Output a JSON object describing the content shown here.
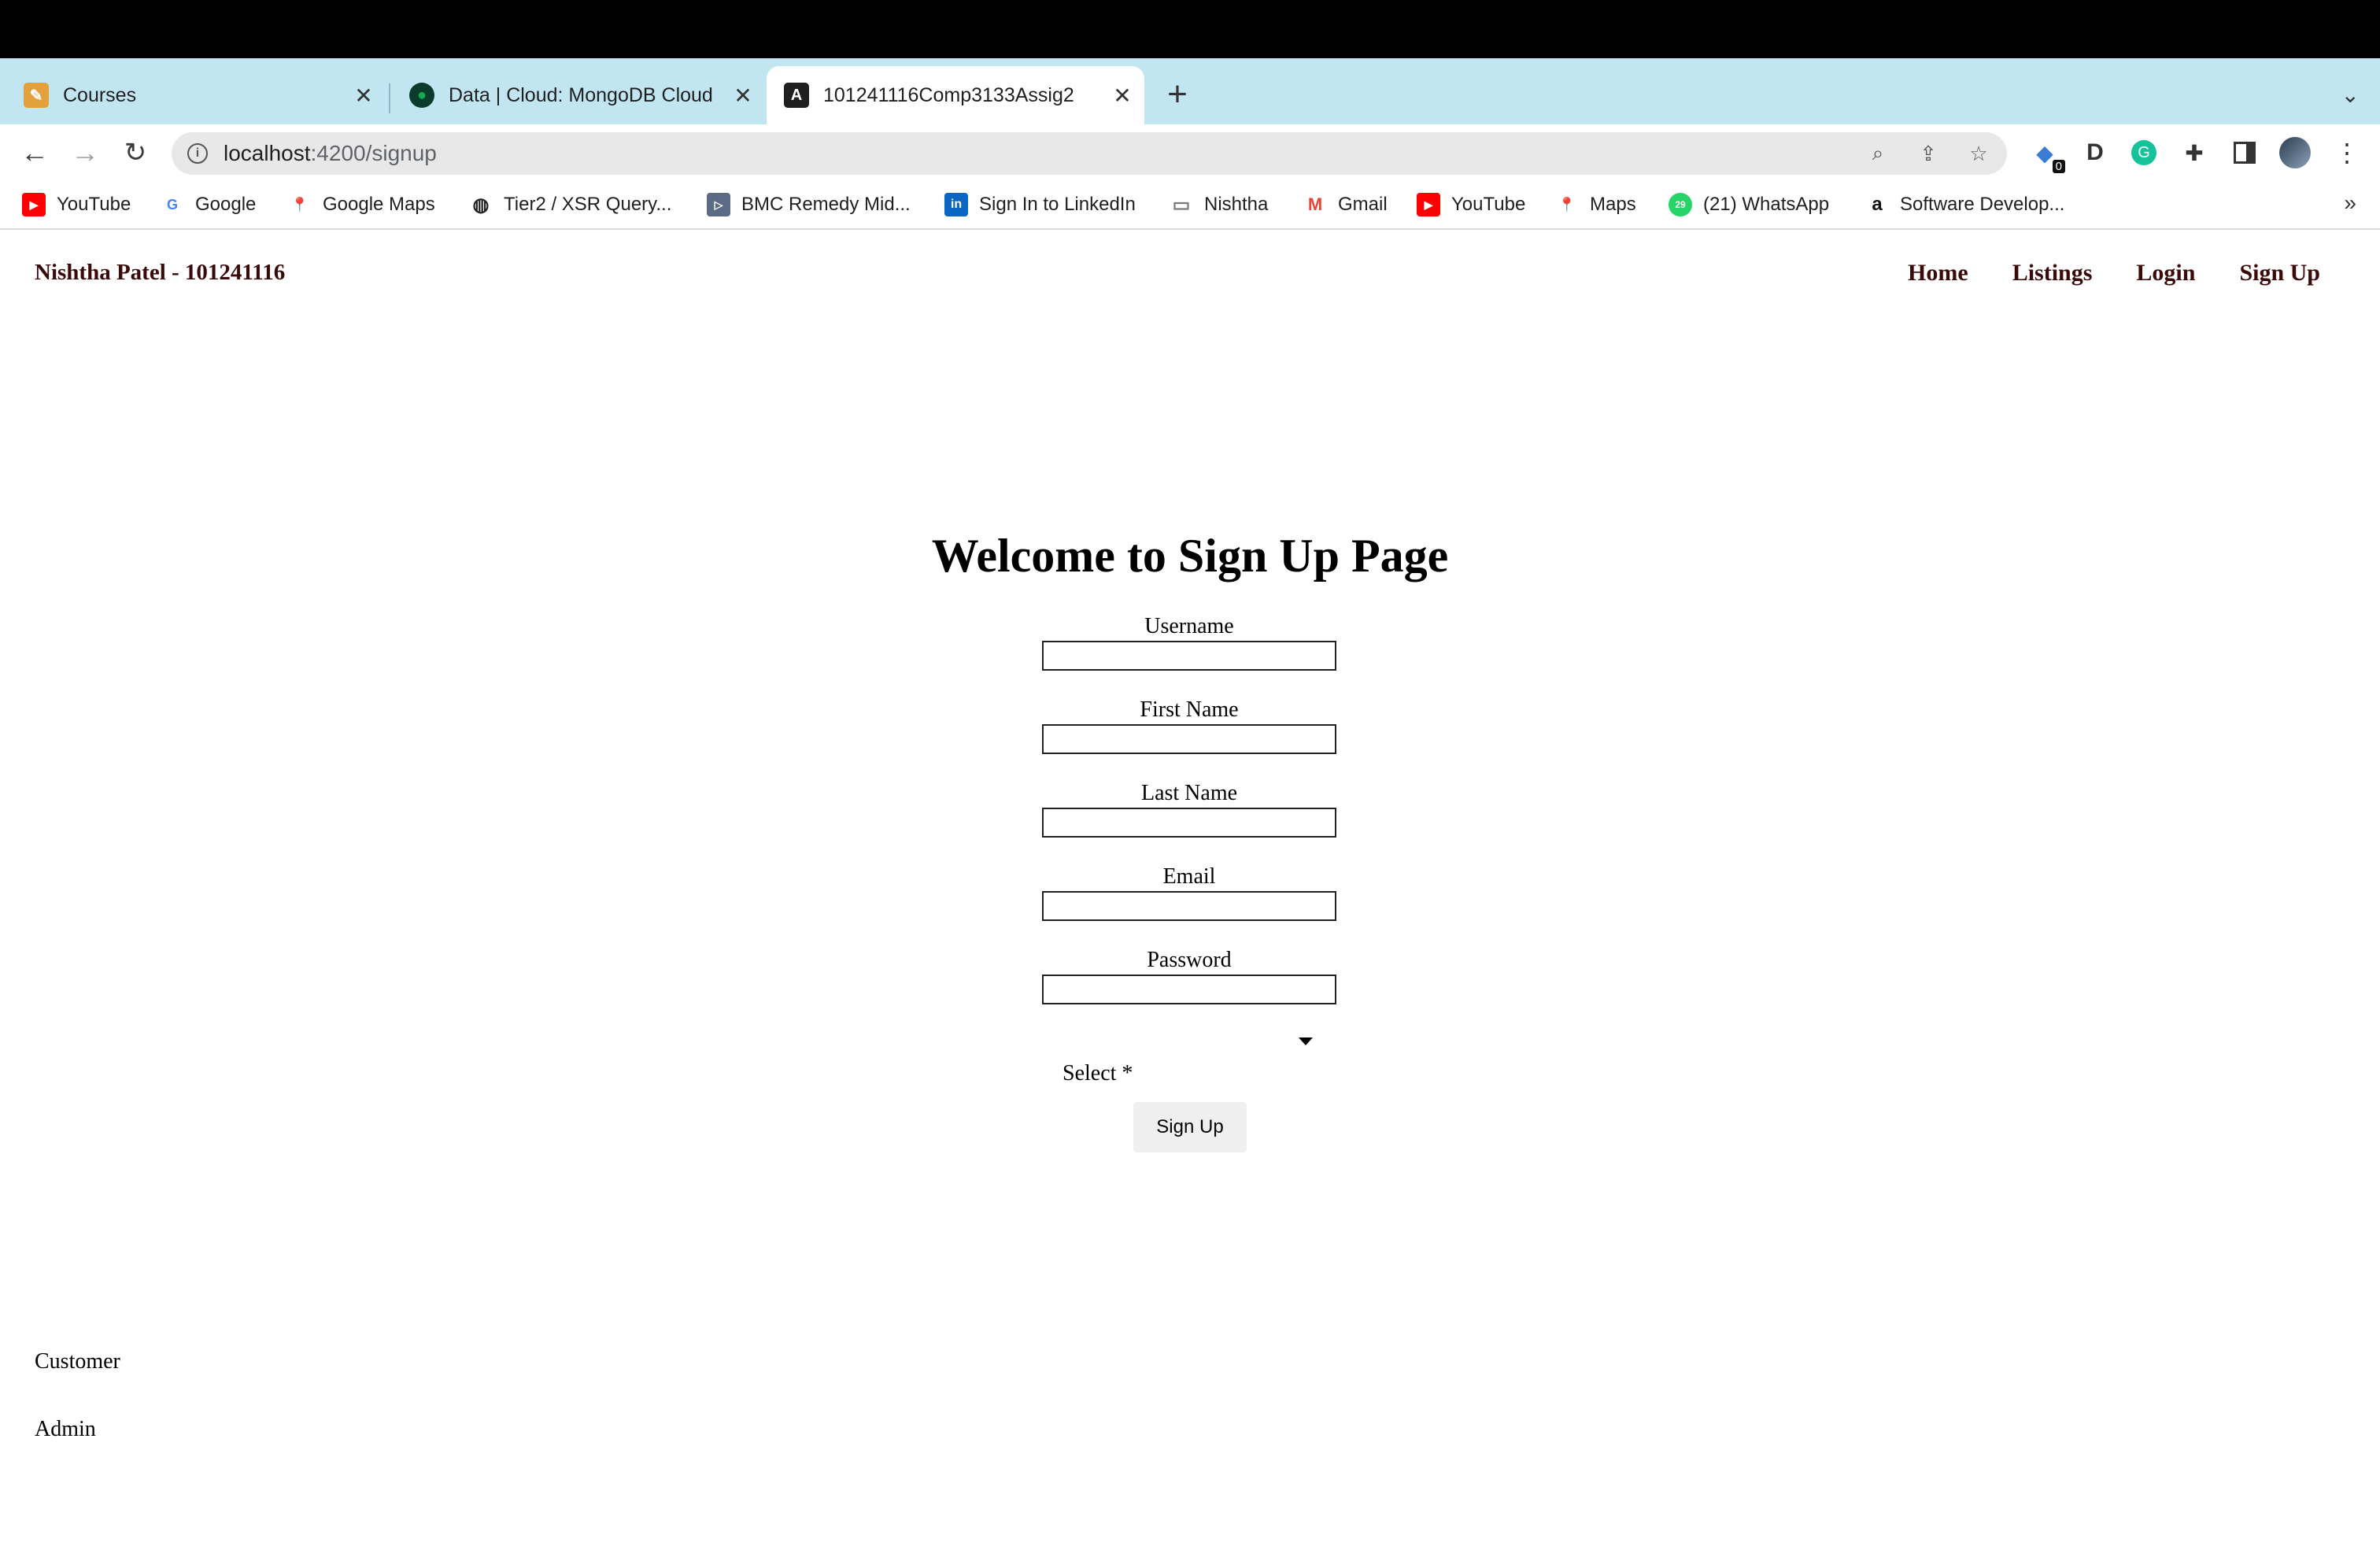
{
  "browser": {
    "tabs": [
      {
        "title": "Courses",
        "icon": "pencil-icon",
        "color": "#e2a13a"
      },
      {
        "title": "Data | Cloud: MongoDB Cloud",
        "icon": "mongodb-leaf-icon",
        "color": "#13aa52"
      },
      {
        "title": "101241116Comp3133Assig2",
        "icon": "angular-icon",
        "color": "#1f1f1f"
      }
    ],
    "url_host": "localhost",
    "url_path": ":4200/signup",
    "extension_badge": "0",
    "bookmarks": [
      {
        "label": "YouTube",
        "icon": "youtube-icon",
        "color": "#ff0000"
      },
      {
        "label": "Google",
        "icon": "google-icon",
        "color": "#4285f4"
      },
      {
        "label": "Google Maps",
        "icon": "maps-pin-icon",
        "color": "#34a853"
      },
      {
        "label": "Tier2 / XSR Query...",
        "icon": "globe-icon",
        "color": "#222222"
      },
      {
        "label": "BMC Remedy Mid...",
        "icon": "bmc-icon",
        "color": "#5b6b86"
      },
      {
        "label": "Sign In to LinkedIn",
        "icon": "linkedin-icon",
        "color": "#0a66c2"
      },
      {
        "label": "Nishtha",
        "icon": "folder-icon",
        "color": "#7a7a7a"
      },
      {
        "label": "Gmail",
        "icon": "gmail-icon",
        "color": "#ea4335"
      },
      {
        "label": "YouTube",
        "icon": "youtube-icon",
        "color": "#ff0000"
      },
      {
        "label": "Maps",
        "icon": "maps-pin-icon",
        "color": "#34a853"
      },
      {
        "label": "(21) WhatsApp",
        "icon": "whatsapp-icon",
        "color": "#25d366"
      },
      {
        "label": "Software Develop...",
        "icon": "amazon-icon",
        "color": "#111111"
      }
    ]
  },
  "page": {
    "brand": "Nishtha Patel - 101241116",
    "nav": {
      "home": "Home",
      "listings": "Listings",
      "login": "Login",
      "signup": "Sign Up"
    },
    "heading": "Welcome to Sign Up Page",
    "form": {
      "username_label": "Username",
      "firstname_label": "First Name",
      "lastname_label": "Last Name",
      "email_label": "Email",
      "password_label": "Password",
      "select_label": "Select *",
      "submit_label": "Sign Up"
    },
    "options": [
      "Customer",
      "Admin"
    ]
  }
}
